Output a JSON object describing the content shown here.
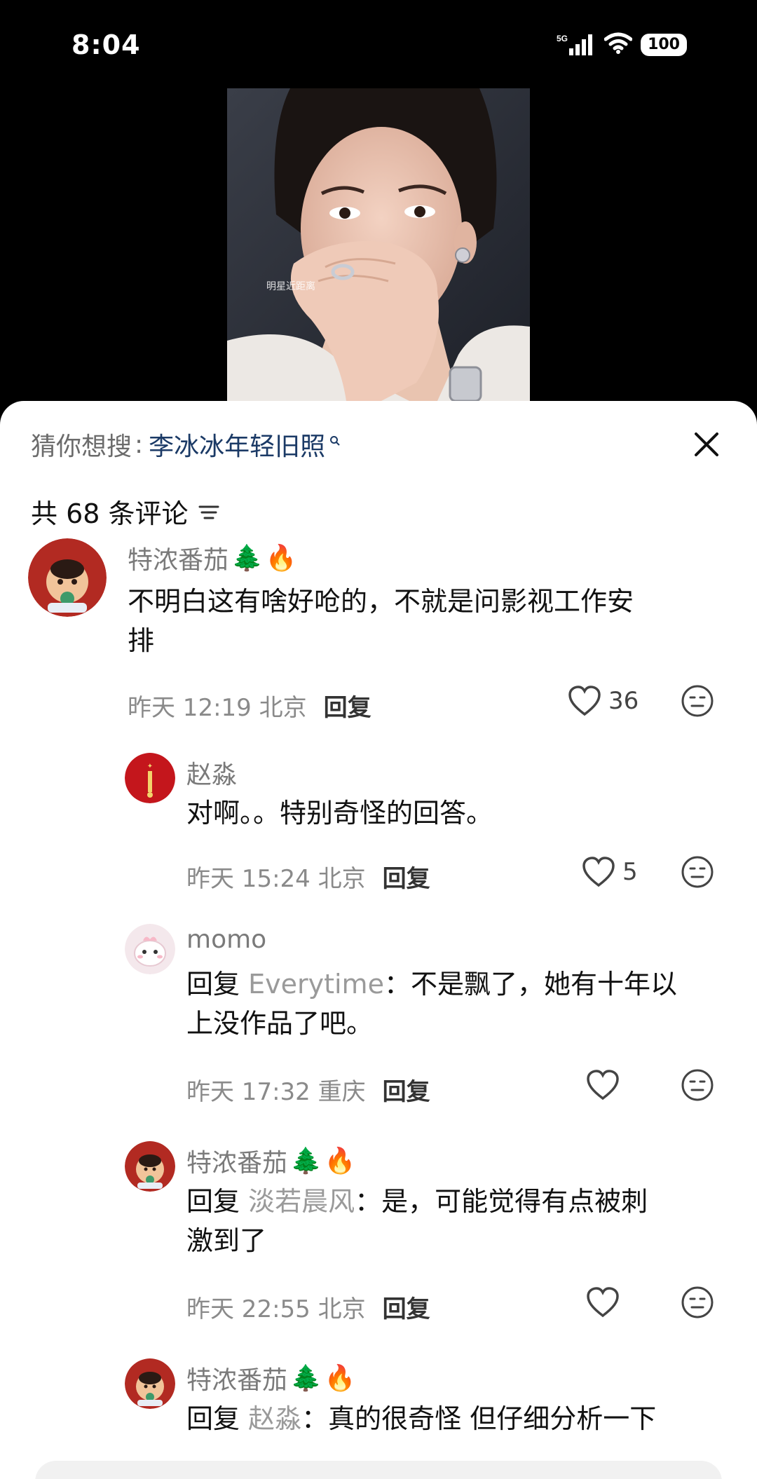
{
  "status": {
    "time": "8:04",
    "network": "5G",
    "battery": "100"
  },
  "video": {
    "watermark": "明星近距离"
  },
  "search": {
    "prefix": "猜你想搜",
    "separator": ":",
    "keyword": "李冰冰年轻旧照"
  },
  "comments_header": {
    "count_label": "共 68 条评论"
  },
  "comments": [
    {
      "name": "特浓番茄",
      "badges": [
        "🌲",
        "🔥"
      ],
      "text_line1": "不明白这有啥好呛的，不就是问影视工作安",
      "text_line2": "排",
      "time": "昨天 12:19 北京",
      "reply_label": "回复",
      "likes": "36"
    },
    {
      "name": "赵淼",
      "text": "对啊。。特别奇怪的回答。",
      "time": "昨天 15:24 北京",
      "reply_label": "回复",
      "likes": "5"
    },
    {
      "name": "momo",
      "reply_prefix": "回复",
      "reply_to": "Everytime",
      "text_line1": "：不是飘了，她有十年以",
      "text_line2": "上没作品了吧。",
      "time": "昨天 17:32 重庆",
      "reply_label": "回复"
    },
    {
      "name": "特浓番茄",
      "badges": [
        "🌲",
        "🔥"
      ],
      "reply_prefix": "回复",
      "reply_to": "淡若晨风",
      "text_line1": "：是，可能觉得有点被刺",
      "text_line2": "激到了",
      "time": "昨天 22:55 北京",
      "reply_label": "回复"
    },
    {
      "name": "特浓番茄",
      "badges": [
        "🌲",
        "🔥"
      ],
      "reply_prefix": "回复",
      "reply_to": "赵淼",
      "text_line1": "：真的很奇怪 但仔细分析一下"
    }
  ]
}
